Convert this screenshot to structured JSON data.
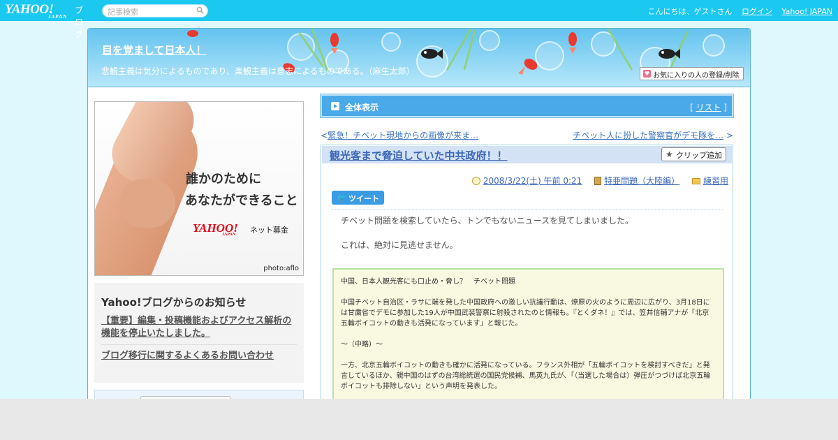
{
  "topbar": {
    "logo_text": "YAHOO!",
    "logo_sub": "JAPAN",
    "logo_blog": "ブログ",
    "search_placeholder": "記事検索",
    "greeting": "こんにちは、ゲストさん",
    "login": "ログイン",
    "yahoo_japan": "Yahoo! JAPAN"
  },
  "header": {
    "blog_title": "目を覚まして日本人！",
    "description": "悲観主義は気分によるものであり、楽観主義は意志によるものである。（麻生太郎）",
    "fav_button": "お気に入りの人の登録/削除"
  },
  "sidebar": {
    "ad": {
      "line1": "誰かのために",
      "line2": "あなたができること",
      "brand": "YAHOO!",
      "brand_sub": "JAPAN",
      "service": "ネット募金",
      "credit": "photo:aflo"
    },
    "notice": {
      "heading": "Yahoo!ブログからのお知らせ",
      "links": [
        "【重要】編集・投稿機能およびアクセス解析の機能を停止いたしました。",
        "ブログ移行に関するよくあるお問い合わせ"
      ]
    }
  },
  "main": {
    "view_all": "全体表示",
    "list_link": "リスト",
    "prev_link": "緊急！チベット現地からの画像が来ま…",
    "next_link": "チベット人に扮した警察官がデモ隊を…",
    "article": {
      "title": "観光客まで脅迫していた中共政府！！",
      "clip_button": "クリップ追加",
      "date": "2008/3/22(土) 午前 0:21",
      "category": "特亜問題（大陸編）",
      "folder": "練習用",
      "tweet": "ツイート",
      "paragraphs": [
        "チベット問題を検索していたら、トンでもないニュースを見てしまいました。",
        "これは、絶対に見逃せません。"
      ],
      "quote": [
        "中国、日本人観光客にも口止め・脅し？　チベット問題",
        "中国チベット自治区・ラサに端を発した中国政府への激しい抗議行動は、燎原の火のように周辺に広がり、3月18日には甘粛省でデモに参加した19人が中国武装警察に射殺されたのと情報も。『とくダネ！』では、笠井信輔アナが「北京五輪ボイコットの動きも活発になっています」と報じた。",
        "～（中略）～",
        "一方、北京五輪ボイコットの動きも確かに活発になっている。フランス外相が「五輪ボイコットを検討すべきだ」と発言しているほか、親中国のはずの台湾総統選の国民党候補、馬英九氏が、「（当選した場合は）弾圧がつづけば北京五輪ボイコットも排除しない」という声明を発表した。"
      ]
    }
  },
  "colors": {
    "topbar": "#1ac8f0",
    "page_bg": "#dff8fd",
    "header_link": "#3b66b8",
    "view_all_bar": "#4aa9e9",
    "quote_bg": "#f9f9e1",
    "quote_border": "#b5e5a0"
  },
  "icons": [
    "search-icon",
    "heart-icon",
    "play-icon",
    "star-icon",
    "clock-icon",
    "book-icon",
    "folder-icon",
    "twitter-bird-icon"
  ]
}
